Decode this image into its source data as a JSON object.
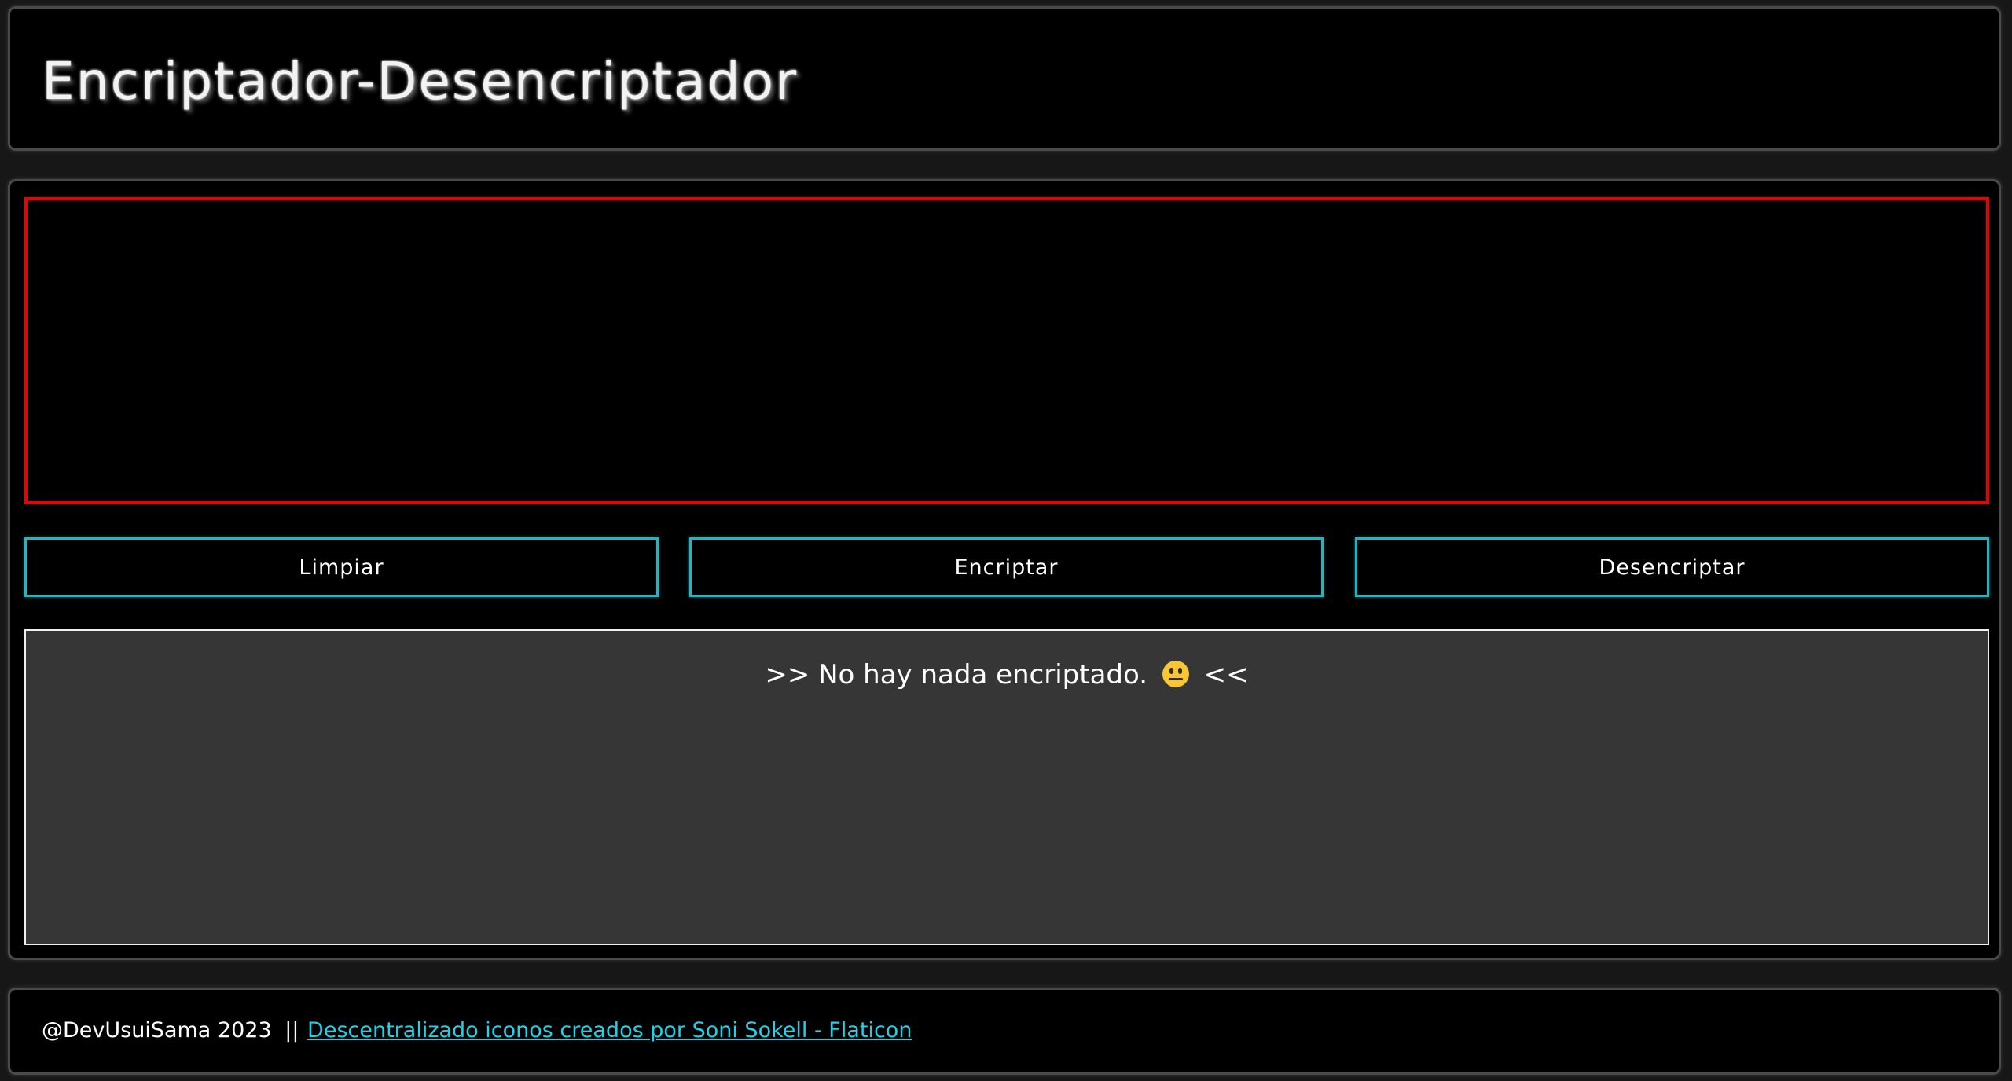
{
  "header": {
    "title": "Encriptador-Desencriptador"
  },
  "input": {
    "value": "",
    "placeholder": ""
  },
  "buttons": {
    "clear_label": "Limpiar",
    "encrypt_label": "Encriptar",
    "decrypt_label": "Desencriptar"
  },
  "output": {
    "prefix": ">> No hay nada encriptado.",
    "emoji_icon": "neutral-face-icon",
    "suffix": "<<"
  },
  "footer": {
    "copyright": "@DevUsuiSama 2023",
    "separator": "||",
    "attribution_link": "Descentralizado iconos creados por Soni Sokell - Flaticon"
  },
  "colors": {
    "input_border": "#ee0000",
    "button_border": "#1fb8c2",
    "link": "#1fd3e6",
    "output_background": "#363636",
    "page_background": "#171717"
  }
}
